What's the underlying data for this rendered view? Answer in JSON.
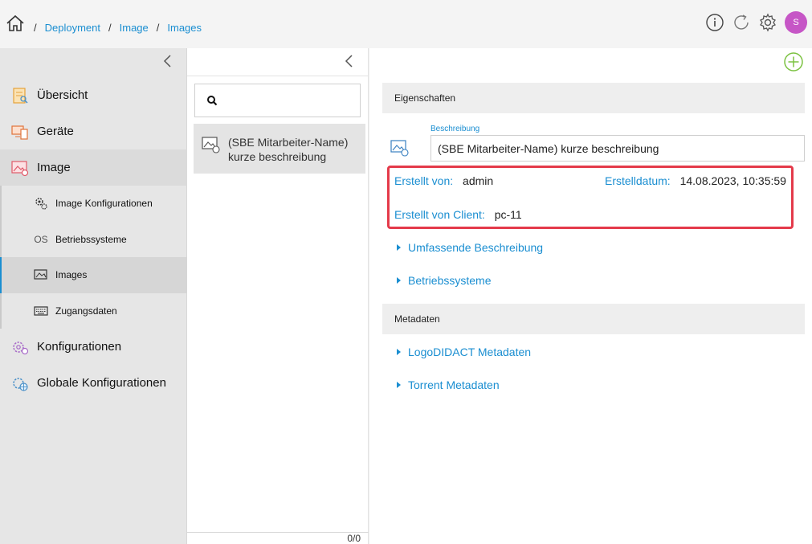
{
  "header": {
    "breadcrumbs": [
      "Deployment",
      "Image",
      "Images"
    ],
    "avatar_initial": "S",
    "icons": [
      "home-icon",
      "info-icon",
      "refresh-icon",
      "gear-icon"
    ]
  },
  "sidebar": {
    "items": [
      {
        "label": "Übersicht",
        "icon": "overview-icon"
      },
      {
        "label": "Geräte",
        "icon": "devices-icon"
      },
      {
        "label": "Image",
        "icon": "image-icon"
      }
    ],
    "subitems": [
      {
        "label": "Image Konfigurationen",
        "icon": "gears-icon"
      },
      {
        "label": "Betriebssysteme",
        "icon_text": "OS"
      },
      {
        "label": "Images",
        "icon": "image-small-icon"
      },
      {
        "label": "Zugangsdaten",
        "icon": "keyboard-icon"
      }
    ],
    "bottom_items": [
      {
        "label": "Konfigurationen",
        "icon": "config-icon"
      },
      {
        "label": "Globale Konfigurationen",
        "icon": "global-config-icon"
      }
    ]
  },
  "list": {
    "search_value": "",
    "item_label": "(SBE Mitarbeiter-Name) kurze beschreibung",
    "counter": "0/0"
  },
  "detail": {
    "eigenschaften_title": "Eigenschaften",
    "beschreibung_label": "Beschreibung",
    "beschreibung_value": "(SBE Mitarbeiter-Name) kurze beschreibung",
    "erstellt_von_label": "Erstellt von:",
    "erstellt_von_value": "admin",
    "erstelldatum_label": "Erstelldatum:",
    "erstelldatum_value": "14.08.2023, 10:35:59",
    "client_label": "Erstellt von Client:",
    "client_value": "pc-11",
    "expander_1": "Umfassende Beschreibung",
    "expander_2": "Betriebssysteme",
    "metadaten_title": "Metadaten",
    "expander_3": "LogoDIDACT Metadaten",
    "expander_4": "Torrent Metadaten"
  },
  "colors": {
    "accent": "#1a8ed1",
    "highlight": "#e43a4a",
    "avatar": "#c656c6",
    "add": "#7cc242"
  }
}
